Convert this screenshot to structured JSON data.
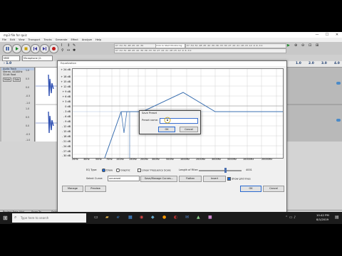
{
  "window": {
    "title": "mp3 file for quiz",
    "minimize": "—",
    "maximize": "☐",
    "close": "✕"
  },
  "menu": [
    "File",
    "Edit",
    "View",
    "Transport",
    "Tracks",
    "Generate",
    "Effect",
    "Analyze",
    "Help"
  ],
  "meters": {
    "record_prompt": "Click to Start Monitoring",
    "rec_scale": "-57 -54 -51 -48 -45 -42 -39",
    "play_scale": "-57 -54 -51 -48 -45 -42 -39 -36 -33 -30 -27 -24 -21 -18 -15 -12 -9 -6 -3 0"
  },
  "device": {
    "host": "MME",
    "input": "Microphone (2-"
  },
  "ruler": {
    "left": "- 1.0",
    "right": [
      "1.0",
      "2.0",
      "3.0",
      "4.0"
    ]
  },
  "track": {
    "name": "Audio Track",
    "info": [
      "Stereo, 44100Hz",
      "32-bit float"
    ],
    "buttons": [
      "Mute",
      "Solo"
    ],
    "scale_top": [
      "1.0",
      "0.5",
      "0.0",
      "-0.5",
      "-1.0"
    ],
    "scale_bottom": [
      "1.0",
      "0.5",
      "0.0",
      "-0.5",
      "-1.0"
    ]
  },
  "equalization": {
    "title": "Equalization",
    "db_labels": [
      "+ 24 dB",
      "+ 18 dB",
      "+ 15 dB",
      "+ 12 dB",
      "+ 9 dB",
      "+ 6 dB",
      "+ 3 dB",
      "0 dB",
      "- 3 dB",
      "- 6 dB",
      "- 9 dB",
      "- 12 dB",
      "- 15 dB",
      "- 18 dB",
      "- 21 dB",
      "- 24 dB",
      "- 27 dB",
      "- 30 dB"
    ],
    "hz_labels": [
      "20Hz",
      "30Hz",
      "50Hz",
      "70Hz",
      "100Hz",
      "150Hz",
      "200Hz",
      "300Hz",
      "500Hz",
      "1000Hz",
      "2000Hz",
      "3000Hz",
      "5000Hz",
      "10000Hz",
      "20000Hz"
    ],
    "eq_type_label": "EQ Type:",
    "eq_type_options": [
      "Draw",
      "Graphic"
    ],
    "eq_type_selected": "Draw",
    "linear_label": "Linear Frequency Scale",
    "length_label": "Length of Filter:",
    "length_value": "4001",
    "select_curve_label": "Select Curve:",
    "select_curve_value": "unnamed",
    "buttons": {
      "save_manage": "Save/Manage Curves...",
      "flatten": "Flatten",
      "invert": "Invert",
      "manage": "Manage",
      "preview": "Preview",
      "ok": "OK",
      "cancel": "Cancel"
    },
    "show_grid_label": "Show grid lines",
    "curve_color": "#3a6fb0"
  },
  "save_preset": {
    "title": "Save Preset",
    "label": "Preset name:",
    "value": "",
    "ok": "OK",
    "cancel": "Cancel"
  },
  "bottom_toolbar": {
    "project_rate_label": "Project Rate (Hz)",
    "project_rate_value": "44100",
    "snap_label": "Snap-To",
    "snap_value": "Off",
    "selection_start_label": "Selection Start",
    "selection_start_value": "0 0 h 0 0 m 0 0 . 0 0 0 s",
    "end_label": "End",
    "length_label": "Length",
    "end_value": "0 0 h 0 0 m 0 0 . 0 0 0 s",
    "audio_position_label": "Audio Position",
    "audio_position_value": "0 0 h 0 0 m 0 0 . 0 0 0 s"
  },
  "status": {
    "left": "Stopped.",
    "right": "Actual Rate: 44100"
  },
  "taskbar": {
    "search_placeholder": "Type here to search",
    "time": "10:42 PM",
    "date": "8/1/2019"
  }
}
